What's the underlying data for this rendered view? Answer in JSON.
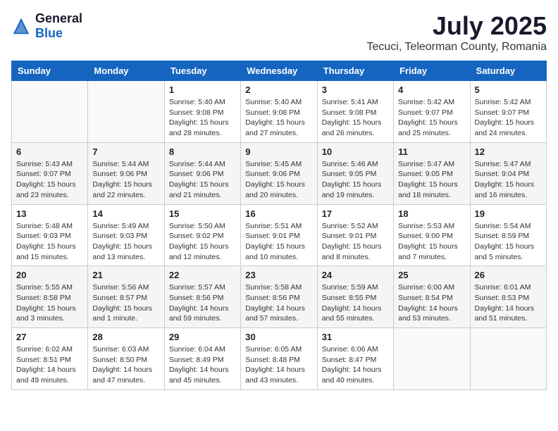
{
  "header": {
    "logo_general": "General",
    "logo_blue": "Blue",
    "title": "July 2025",
    "subtitle": "Tecuci, Teleorman County, Romania"
  },
  "days_of_week": [
    "Sunday",
    "Monday",
    "Tuesday",
    "Wednesday",
    "Thursday",
    "Friday",
    "Saturday"
  ],
  "weeks": [
    [
      {
        "day": "",
        "info": ""
      },
      {
        "day": "",
        "info": ""
      },
      {
        "day": "1",
        "info": "Sunrise: 5:40 AM\nSunset: 9:08 PM\nDaylight: 15 hours and 28 minutes."
      },
      {
        "day": "2",
        "info": "Sunrise: 5:40 AM\nSunset: 9:08 PM\nDaylight: 15 hours and 27 minutes."
      },
      {
        "day": "3",
        "info": "Sunrise: 5:41 AM\nSunset: 9:08 PM\nDaylight: 15 hours and 26 minutes."
      },
      {
        "day": "4",
        "info": "Sunrise: 5:42 AM\nSunset: 9:07 PM\nDaylight: 15 hours and 25 minutes."
      },
      {
        "day": "5",
        "info": "Sunrise: 5:42 AM\nSunset: 9:07 PM\nDaylight: 15 hours and 24 minutes."
      }
    ],
    [
      {
        "day": "6",
        "info": "Sunrise: 5:43 AM\nSunset: 9:07 PM\nDaylight: 15 hours and 23 minutes."
      },
      {
        "day": "7",
        "info": "Sunrise: 5:44 AM\nSunset: 9:06 PM\nDaylight: 15 hours and 22 minutes."
      },
      {
        "day": "8",
        "info": "Sunrise: 5:44 AM\nSunset: 9:06 PM\nDaylight: 15 hours and 21 minutes."
      },
      {
        "day": "9",
        "info": "Sunrise: 5:45 AM\nSunset: 9:06 PM\nDaylight: 15 hours and 20 minutes."
      },
      {
        "day": "10",
        "info": "Sunrise: 5:46 AM\nSunset: 9:05 PM\nDaylight: 15 hours and 19 minutes."
      },
      {
        "day": "11",
        "info": "Sunrise: 5:47 AM\nSunset: 9:05 PM\nDaylight: 15 hours and 18 minutes."
      },
      {
        "day": "12",
        "info": "Sunrise: 5:47 AM\nSunset: 9:04 PM\nDaylight: 15 hours and 16 minutes."
      }
    ],
    [
      {
        "day": "13",
        "info": "Sunrise: 5:48 AM\nSunset: 9:03 PM\nDaylight: 15 hours and 15 minutes."
      },
      {
        "day": "14",
        "info": "Sunrise: 5:49 AM\nSunset: 9:03 PM\nDaylight: 15 hours and 13 minutes."
      },
      {
        "day": "15",
        "info": "Sunrise: 5:50 AM\nSunset: 9:02 PM\nDaylight: 15 hours and 12 minutes."
      },
      {
        "day": "16",
        "info": "Sunrise: 5:51 AM\nSunset: 9:01 PM\nDaylight: 15 hours and 10 minutes."
      },
      {
        "day": "17",
        "info": "Sunrise: 5:52 AM\nSunset: 9:01 PM\nDaylight: 15 hours and 8 minutes."
      },
      {
        "day": "18",
        "info": "Sunrise: 5:53 AM\nSunset: 9:00 PM\nDaylight: 15 hours and 7 minutes."
      },
      {
        "day": "19",
        "info": "Sunrise: 5:54 AM\nSunset: 8:59 PM\nDaylight: 15 hours and 5 minutes."
      }
    ],
    [
      {
        "day": "20",
        "info": "Sunrise: 5:55 AM\nSunset: 8:58 PM\nDaylight: 15 hours and 3 minutes."
      },
      {
        "day": "21",
        "info": "Sunrise: 5:56 AM\nSunset: 8:57 PM\nDaylight: 15 hours and 1 minute."
      },
      {
        "day": "22",
        "info": "Sunrise: 5:57 AM\nSunset: 8:56 PM\nDaylight: 14 hours and 59 minutes."
      },
      {
        "day": "23",
        "info": "Sunrise: 5:58 AM\nSunset: 8:56 PM\nDaylight: 14 hours and 57 minutes."
      },
      {
        "day": "24",
        "info": "Sunrise: 5:59 AM\nSunset: 8:55 PM\nDaylight: 14 hours and 55 minutes."
      },
      {
        "day": "25",
        "info": "Sunrise: 6:00 AM\nSunset: 8:54 PM\nDaylight: 14 hours and 53 minutes."
      },
      {
        "day": "26",
        "info": "Sunrise: 6:01 AM\nSunset: 8:53 PM\nDaylight: 14 hours and 51 minutes."
      }
    ],
    [
      {
        "day": "27",
        "info": "Sunrise: 6:02 AM\nSunset: 8:51 PM\nDaylight: 14 hours and 49 minutes."
      },
      {
        "day": "28",
        "info": "Sunrise: 6:03 AM\nSunset: 8:50 PM\nDaylight: 14 hours and 47 minutes."
      },
      {
        "day": "29",
        "info": "Sunrise: 6:04 AM\nSunset: 8:49 PM\nDaylight: 14 hours and 45 minutes."
      },
      {
        "day": "30",
        "info": "Sunrise: 6:05 AM\nSunset: 8:48 PM\nDaylight: 14 hours and 43 minutes."
      },
      {
        "day": "31",
        "info": "Sunrise: 6:06 AM\nSunset: 8:47 PM\nDaylight: 14 hours and 40 minutes."
      },
      {
        "day": "",
        "info": ""
      },
      {
        "day": "",
        "info": ""
      }
    ]
  ]
}
